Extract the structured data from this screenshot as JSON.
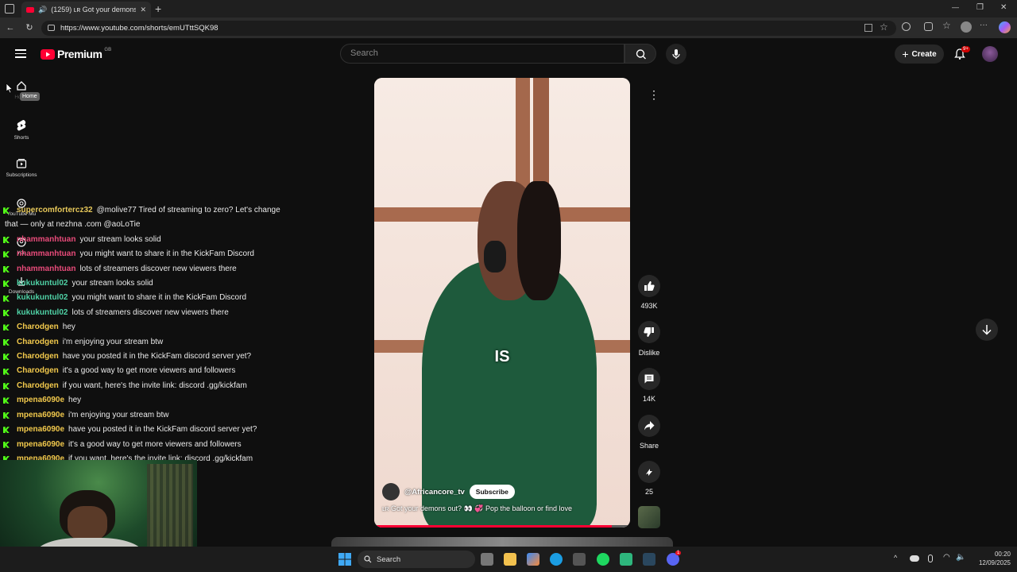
{
  "browser": {
    "tab_title": "(1259) ʟʀ Got your demons out? 👀 Pop the balloon or find love",
    "url": "https://www.youtube.com/shorts/emUTttSQK98",
    "new_tab": "+",
    "back": "←",
    "reload": "↻",
    "minimize": "—",
    "maximize": "❐",
    "close": "✕",
    "more": "···"
  },
  "youtube": {
    "logo_text": "Premium",
    "region": "GB",
    "search_placeholder": "Search",
    "create_label": "Create",
    "notification_count": "9+",
    "tooltip": "Home",
    "nav": {
      "home": "Home",
      "shorts": "Shorts",
      "subscriptions": "Subscriptions",
      "youtube_music": "YouTube Mu",
      "you": "You",
      "downloads": "Downloads"
    }
  },
  "short": {
    "caption_word": "IS",
    "channel": "@Africancore_tv",
    "subscribe_label": "Subscribe",
    "title": "ʟʀ Got your demons out? 👀 💞 Pop the balloon or find love",
    "likes": "493K",
    "dislike_label": "Dislike",
    "comments": "14K",
    "share_label": "Share",
    "remix_count": "25",
    "progress": 0.93
  },
  "chat": [
    {
      "user": "supercomfortercz32",
      "color": "#e8c95a",
      "message": "@molive77 Tired of streaming to zero? Let's change"
    },
    {
      "user": "",
      "color": "#ffffff",
      "message": "that — only at nezhna .com @aoLoTie"
    },
    {
      "user": "nhammanhtuan",
      "color": "#e84b7a",
      "message": "your stream looks solid"
    },
    {
      "user": "nhammanhtuan",
      "color": "#e84b7a",
      "message": "you might want to share it in the KickFam Discord"
    },
    {
      "user": "nhammanhtuan",
      "color": "#e84b7a",
      "message": "lots of streamers discover new viewers there"
    },
    {
      "user": "kukukuntul02",
      "color": "#4fd1a5",
      "message": "your stream looks solid"
    },
    {
      "user": "kukukuntul02",
      "color": "#4fd1a5",
      "message": "you might want to share it in the KickFam Discord"
    },
    {
      "user": "kukukuntul02",
      "color": "#4fd1a5",
      "message": "lots of streamers discover new viewers there"
    },
    {
      "user": "Charodgen",
      "color": "#f2c94c",
      "message": "hey"
    },
    {
      "user": "Charodgen",
      "color": "#f2c94c",
      "message": "i'm enjoying your stream btw"
    },
    {
      "user": "Charodgen",
      "color": "#f2c94c",
      "message": "have you posted it in the KickFam discord server yet?"
    },
    {
      "user": "Charodgen",
      "color": "#f2c94c",
      "message": "it's a good way to get more viewers and followers"
    },
    {
      "user": "Charodgen",
      "color": "#f2c94c",
      "message": "if you want, here's the invite link: discord .gg/kickfam"
    },
    {
      "user": "mpena6090e",
      "color": "#f2c94c",
      "message": "hey"
    },
    {
      "user": "mpena6090e",
      "color": "#f2c94c",
      "message": "i'm enjoying your stream btw"
    },
    {
      "user": "mpena6090e",
      "color": "#f2c94c",
      "message": "have you posted it in the KickFam discord server yet?"
    },
    {
      "user": "mpena6090e",
      "color": "#f2c94c",
      "message": "it's a good way to get more viewers and followers"
    },
    {
      "user": "mpena6090e",
      "color": "#f2c94c",
      "message": "if you want, here's the invite link: discord .gg/kickfam"
    }
  ],
  "taskbar": {
    "search_label": "Search",
    "time": "00:20",
    "date": "12/09/2025",
    "discord_badge": "1"
  },
  "colors": {
    "youtube_red": "#ff0033",
    "kick_green": "#53fc18",
    "dress_green": "#1e5a3c"
  }
}
